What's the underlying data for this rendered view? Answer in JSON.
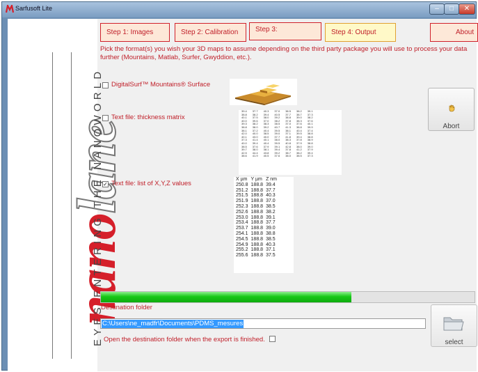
{
  "window": {
    "title": "Sarfusoft Lite",
    "minimize": "–",
    "maximize": "□",
    "close": "✕",
    "icon": "app-logo-icon"
  },
  "sidebar": {
    "logo_part1": "nano",
    "logo_part2": "lane",
    "tagline": "EYES ENTERING THE NANOWORLD"
  },
  "tabs": [
    {
      "label": "Step 1: Images"
    },
    {
      "label": "Step 2: Calibration"
    },
    {
      "label": "Step 3:"
    },
    {
      "label": "Step 4: Output",
      "active": true
    },
    {
      "label": "About"
    }
  ],
  "instructions": "Pick the format(s) you wish your 3D maps to assume depending on the third party package you will use to process your data further (Mountains, Matlab, Surfer, Gwyddion, etc.).",
  "options": [
    {
      "label": "DigitalSurf™ Mountains® Surface",
      "checked": false
    },
    {
      "label": "Text file: thickness matrix",
      "checked": false
    },
    {
      "label": "Text file: list of X,Y,Z values",
      "checked": true
    }
  ],
  "check_mark": "✓",
  "matrix_preview": [
    [
      "39.4",
      "37.7",
      "40.3",
      "37.0",
      "38.5",
      "38.2",
      "39.1"
    ],
    [
      "38.8",
      "38.2",
      "39.4",
      "40.5",
      "37.7",
      "38.7",
      "37.3"
    ],
    [
      "40.1",
      "37.5",
      "38.0",
      "39.2",
      "38.8",
      "39.0",
      "38.2"
    ],
    [
      "40.0",
      "39.6",
      "37.0",
      "38.2",
      "37.8",
      "38.3",
      "37.6"
    ],
    [
      "39.3",
      "38.2",
      "38.3",
      "38.5",
      "37.0",
      "37.6",
      "40.1"
    ],
    [
      "38.8",
      "38.0",
      "39.2",
      "40.7",
      "41.3",
      "38.8",
      "39.9"
    ],
    [
      "38.1",
      "37.2",
      "40.4",
      "39.5",
      "38.1",
      "40.4",
      "37.4"
    ],
    [
      "42.0",
      "40.0",
      "38.5",
      "39.0",
      "37.1",
      "39.5",
      "38.8"
    ],
    [
      "40.1",
      "43.0",
      "40.0",
      "37.7",
      "41.8",
      "39.4",
      "38.8"
    ],
    [
      "37.3",
      "41.4",
      "40.1",
      "38.0",
      "38.3",
      "37.8",
      "38.9"
    ],
    [
      "40.0",
      "39.4",
      "40.4",
      "39.5",
      "40.8",
      "37.9",
      "38.8"
    ],
    [
      "38.5",
      "37.6",
      "37.9",
      "39.1",
      "42.8",
      "38.0",
      "39.0"
    ],
    [
      "39.7",
      "38.0",
      "38.1",
      "39.4",
      "37.8",
      "41.2",
      "37.9"
    ],
    [
      "42.5",
      "44.4",
      "43.8",
      "39.2",
      "38.7",
      "38.2",
      "39.4"
    ],
    [
      "38.6",
      "41.9",
      "40.5",
      "37.6",
      "38.0",
      "38.5",
      "37.3"
    ]
  ],
  "xyz_preview": {
    "headers": [
      "X µm",
      "Y µm",
      "Z nm"
    ],
    "rows": [
      [
        "250.8",
        "188.8",
        "39.4"
      ],
      [
        "251.2",
        "188.8",
        "37.7"
      ],
      [
        "251.5",
        "188.8",
        "40.3"
      ],
      [
        "251.9",
        "188.8",
        "37.0"
      ],
      [
        "252.3",
        "188.8",
        "38.5"
      ],
      [
        "252.6",
        "188.8",
        "38.2"
      ],
      [
        "253.0",
        "188.8",
        "39.1"
      ],
      [
        "253.4",
        "188.8",
        "37.7"
      ],
      [
        "253.7",
        "188.8",
        "39.0"
      ],
      [
        "254.1",
        "188.8",
        "38.8"
      ],
      [
        "254.5",
        "188.8",
        "38.5"
      ],
      [
        "254.9",
        "188.8",
        "40.3"
      ],
      [
        "255.2",
        "188.8",
        "37.1"
      ],
      [
        "255.6",
        "188.8",
        "37.5"
      ]
    ]
  },
  "abort_button": {
    "label": "Abort",
    "icon": "stop-hand-icon"
  },
  "progress": {
    "fraction": 0.67
  },
  "destination": {
    "label": "Destination folder",
    "path": "C:\\Users\\ne_madfr\\Documents\\PDMS_mesures",
    "open_when_finished_label": "Open the destination folder when the export is finished.",
    "open_when_finished": false
  },
  "select_button": {
    "label": "select",
    "icon": "folder-icon"
  },
  "colors": {
    "accent_red": "#c0202a",
    "progress_green": "#17c817",
    "active_tab": "#fff9c8",
    "selection_blue": "#3399ff"
  }
}
